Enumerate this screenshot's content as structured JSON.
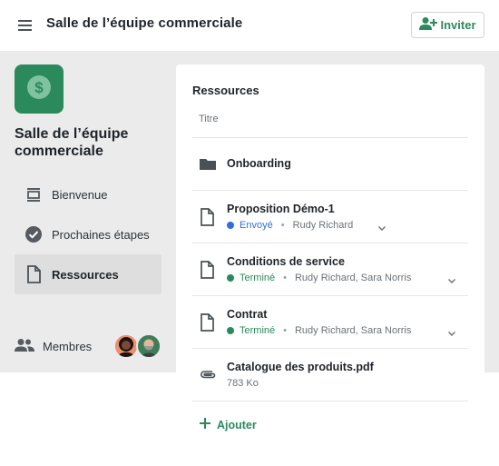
{
  "header": {
    "title": "Salle de l’équipe commerciale",
    "invite_label": "Inviter"
  },
  "colors": {
    "brand": "#2a8a5c",
    "sent": "#2f6fe0",
    "done": "#2a8a5c"
  },
  "sidebar": {
    "room_name": "Salle de l’équipe commerciale",
    "logo_icon": "dollar-icon",
    "items": [
      {
        "label": "Bienvenue",
        "icon": "welcome-icon",
        "active": false
      },
      {
        "label": "Prochaines étapes",
        "icon": "check-circle-icon",
        "active": false
      },
      {
        "label": "Ressources",
        "icon": "document-icon",
        "active": true
      }
    ],
    "members_label": "Membres"
  },
  "resources": {
    "title": "Ressources",
    "column_header": "Titre",
    "items": [
      {
        "name": "Onboarding",
        "type": "folder"
      },
      {
        "name": "Proposition Démo-1",
        "type": "document",
        "status": "Envoyé",
        "people": "Rudy Richard"
      },
      {
        "name": "Conditions de service",
        "type": "document",
        "status": "Terminé",
        "people": "Rudy Richard, Sara Norris"
      },
      {
        "name": "Contrat",
        "type": "document",
        "status": "Terminé",
        "people": "Rudy Richard, Sara Norris"
      },
      {
        "name": "Catalogue des produits.pdf",
        "type": "attachment",
        "size": "783 Ko"
      }
    ],
    "add_label": "Ajouter"
  }
}
